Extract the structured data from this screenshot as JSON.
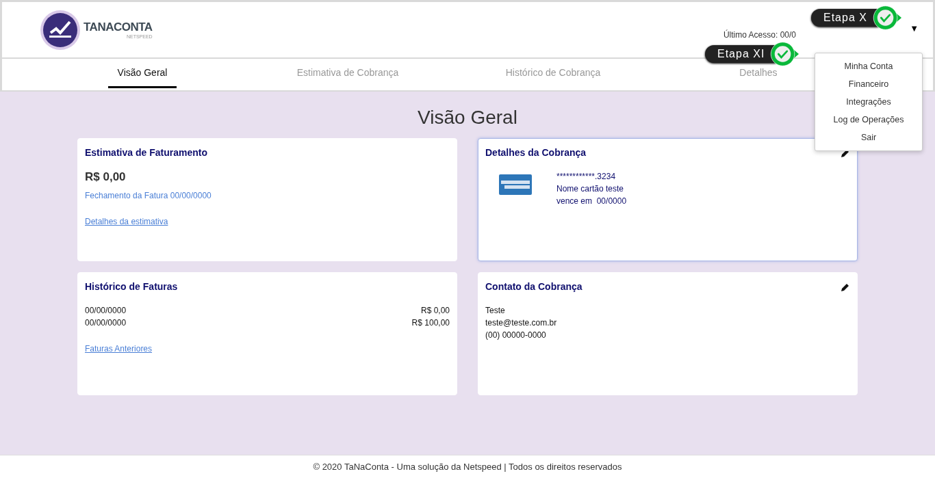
{
  "header": {
    "logo_text": "TANACONTA",
    "logo_subtext": "NETSPEED",
    "last_access": "Último Acesso: 00/0",
    "menu_caret": "▼"
  },
  "tabs": [
    {
      "label": "Visão Geral",
      "selected": true
    },
    {
      "label": "Estimativa de Cobrança",
      "selected": false
    },
    {
      "label": "Histórico de Cobrança",
      "selected": false
    },
    {
      "label": "Detalhes",
      "selected": false
    }
  ],
  "user_menu": {
    "items": [
      "Minha Conta",
      "Financeiro",
      "Integrações",
      "Log de Operações",
      "Sair"
    ]
  },
  "tour_steps": [
    {
      "label": "Etapa X",
      "done": true
    },
    {
      "label": "Etapa XI",
      "done": true
    }
  ],
  "page_title": "Visão Geral",
  "cards": [
    {
      "kind": "estimate",
      "title": "Estimativa de Faturamento",
      "amount": "R$ 0,00",
      "closing": "Fechamento da Fatura 00/00/0000",
      "link": "Detalhes da estimativa",
      "editable": false,
      "highlighted": false
    },
    {
      "kind": "card",
      "title": "Detalhes da Cobrança",
      "card_number": "************.3234",
      "card_name": "Nome cartão teste",
      "expiry": "vence em  00/0000",
      "editable": true,
      "highlighted": true
    },
    {
      "kind": "history",
      "title": "Histórico de Faturas",
      "rows": [
        {
          "date": "00/00/0000",
          "amount": "R$ 0,00"
        },
        {
          "date": "00/00/0000",
          "amount": "R$ 100,00"
        }
      ],
      "link": "Faturas Anteriores",
      "editable": false,
      "highlighted": false
    },
    {
      "kind": "contact",
      "title": "Contato da Cobrança",
      "lines": [
        "Teste",
        "teste@teste.com.br",
        "(00) 00000-0000"
      ],
      "editable": true,
      "highlighted": false
    }
  ],
  "footer": "© 2020 TaNaConta - Uma solução da Netspeed | Todos os direitos reservados"
}
